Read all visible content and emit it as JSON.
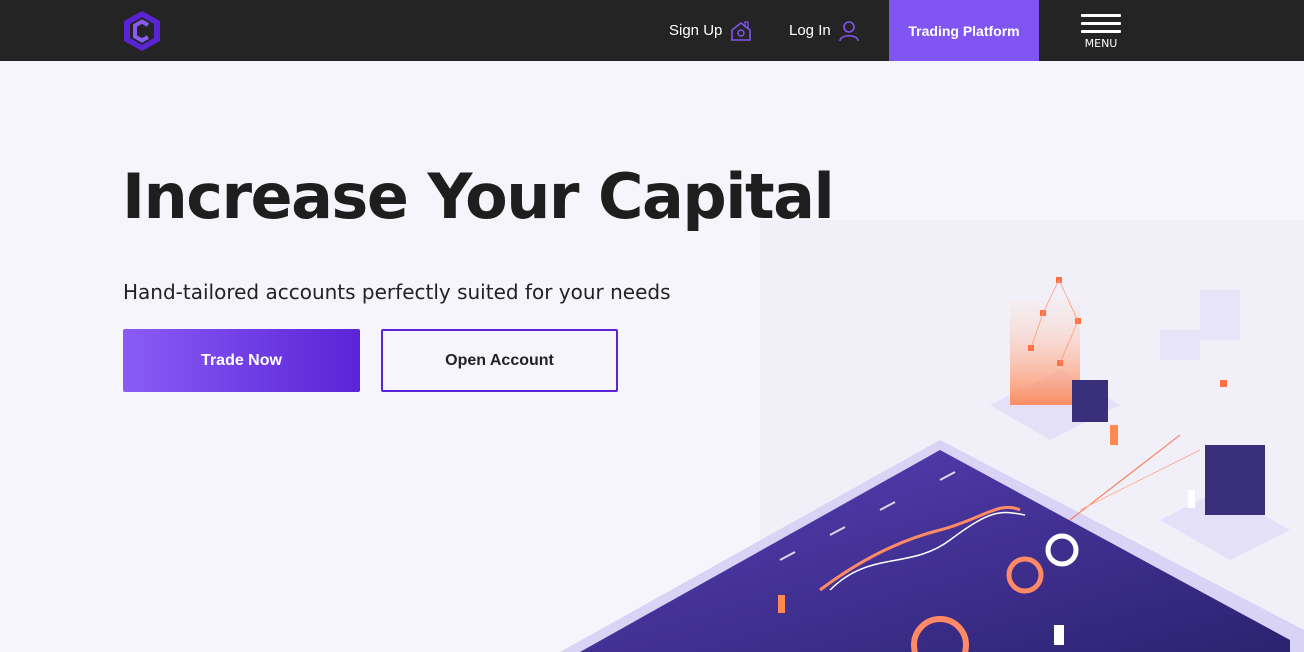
{
  "header": {
    "logo_icon": "c-hexagon-logo",
    "signup_label": "Sign Up",
    "signup_icon": "house-icon",
    "login_label": "Log In",
    "login_icon": "user-icon",
    "trading_platform_label": "Trading Platform",
    "menu_label": "MENU",
    "menu_icon": "hamburger-icon"
  },
  "hero": {
    "title": "Increase Your Capital",
    "subtitle": "Hand-tailored accounts perfectly suited for your needs",
    "trade_button_label": "Trade Now",
    "open_account_button_label": "Open Account",
    "illustration": "isometric-crypto-trading-illustration"
  },
  "colors": {
    "header_bg": "#242424",
    "accent": "#8155f2",
    "accent_dark": "#5b23d6",
    "page_bg": "#f6f5fb",
    "text": "#1e1e1e"
  }
}
